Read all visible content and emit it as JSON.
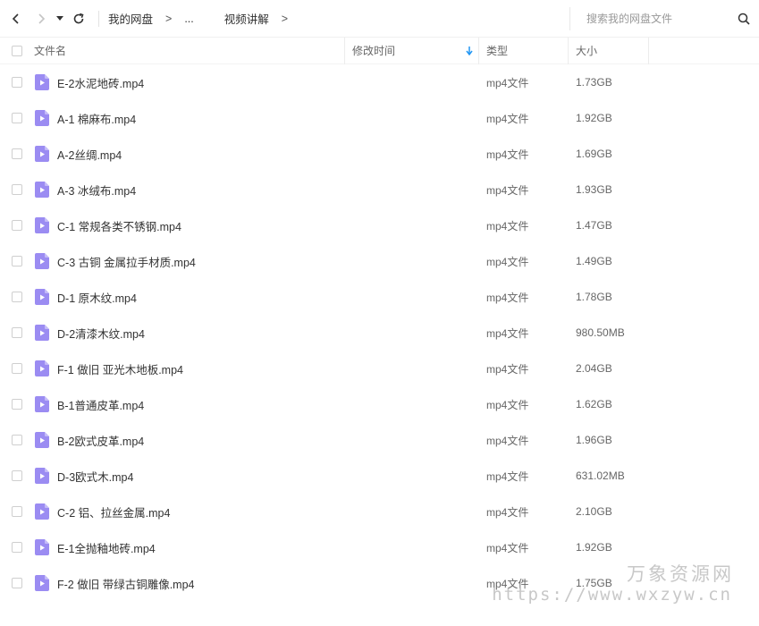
{
  "nav": {
    "breadcrumbs": [
      "我的网盘",
      "...",
      "视频讲解"
    ],
    "separator": ">"
  },
  "search": {
    "placeholder": "搜索我的网盘文件"
  },
  "columns": {
    "name": "文件名",
    "modified": "修改时间",
    "type": "类型",
    "size": "大小"
  },
  "files": [
    {
      "name": "E-2水泥地砖.mp4",
      "type": "mp4文件",
      "size": "1.73GB"
    },
    {
      "name": "A-1 棉麻布.mp4",
      "type": "mp4文件",
      "size": "1.92GB"
    },
    {
      "name": "A-2丝绸.mp4",
      "type": "mp4文件",
      "size": "1.69GB"
    },
    {
      "name": "A-3 冰绒布.mp4",
      "type": "mp4文件",
      "size": "1.93GB"
    },
    {
      "name": "C-1 常规各类不锈钢.mp4",
      "type": "mp4文件",
      "size": "1.47GB"
    },
    {
      "name": "C-3 古铜 金属拉手材质.mp4",
      "type": "mp4文件",
      "size": "1.49GB"
    },
    {
      "name": "D-1 原木纹.mp4",
      "type": "mp4文件",
      "size": "1.78GB"
    },
    {
      "name": "D-2清漆木纹.mp4",
      "type": "mp4文件",
      "size": "980.50MB"
    },
    {
      "name": "F-1 做旧 亚光木地板.mp4",
      "type": "mp4文件",
      "size": "2.04GB"
    },
    {
      "name": "B-1普通皮革.mp4",
      "type": "mp4文件",
      "size": "1.62GB"
    },
    {
      "name": "B-2欧式皮革.mp4",
      "type": "mp4文件",
      "size": "1.96GB"
    },
    {
      "name": "D-3欧式木.mp4",
      "type": "mp4文件",
      "size": "631.02MB"
    },
    {
      "name": "C-2 铝、拉丝金属.mp4",
      "type": "mp4文件",
      "size": "2.10GB"
    },
    {
      "name": "E-1全抛釉地砖.mp4",
      "type": "mp4文件",
      "size": "1.92GB"
    },
    {
      "name": "F-2 做旧 带绿古铜雕像.mp4",
      "type": "mp4文件",
      "size": "1.75GB"
    }
  ],
  "watermark": {
    "cn": "万象资源网",
    "url": "https://www.wxzyw.cn"
  },
  "icons": {
    "back": "chevron-left-icon",
    "forward": "chevron-right-icon",
    "history": "caret-down-icon",
    "refresh": "refresh-icon",
    "search": "search-icon",
    "sort": "arrow-down-icon",
    "file": "video-file-icon"
  },
  "colors": {
    "video_icon": "#9b8cf2",
    "sort_arrow": "#2196f3",
    "disabled_nav": "#c4c4c4",
    "watermark": "#c8c8c8"
  }
}
